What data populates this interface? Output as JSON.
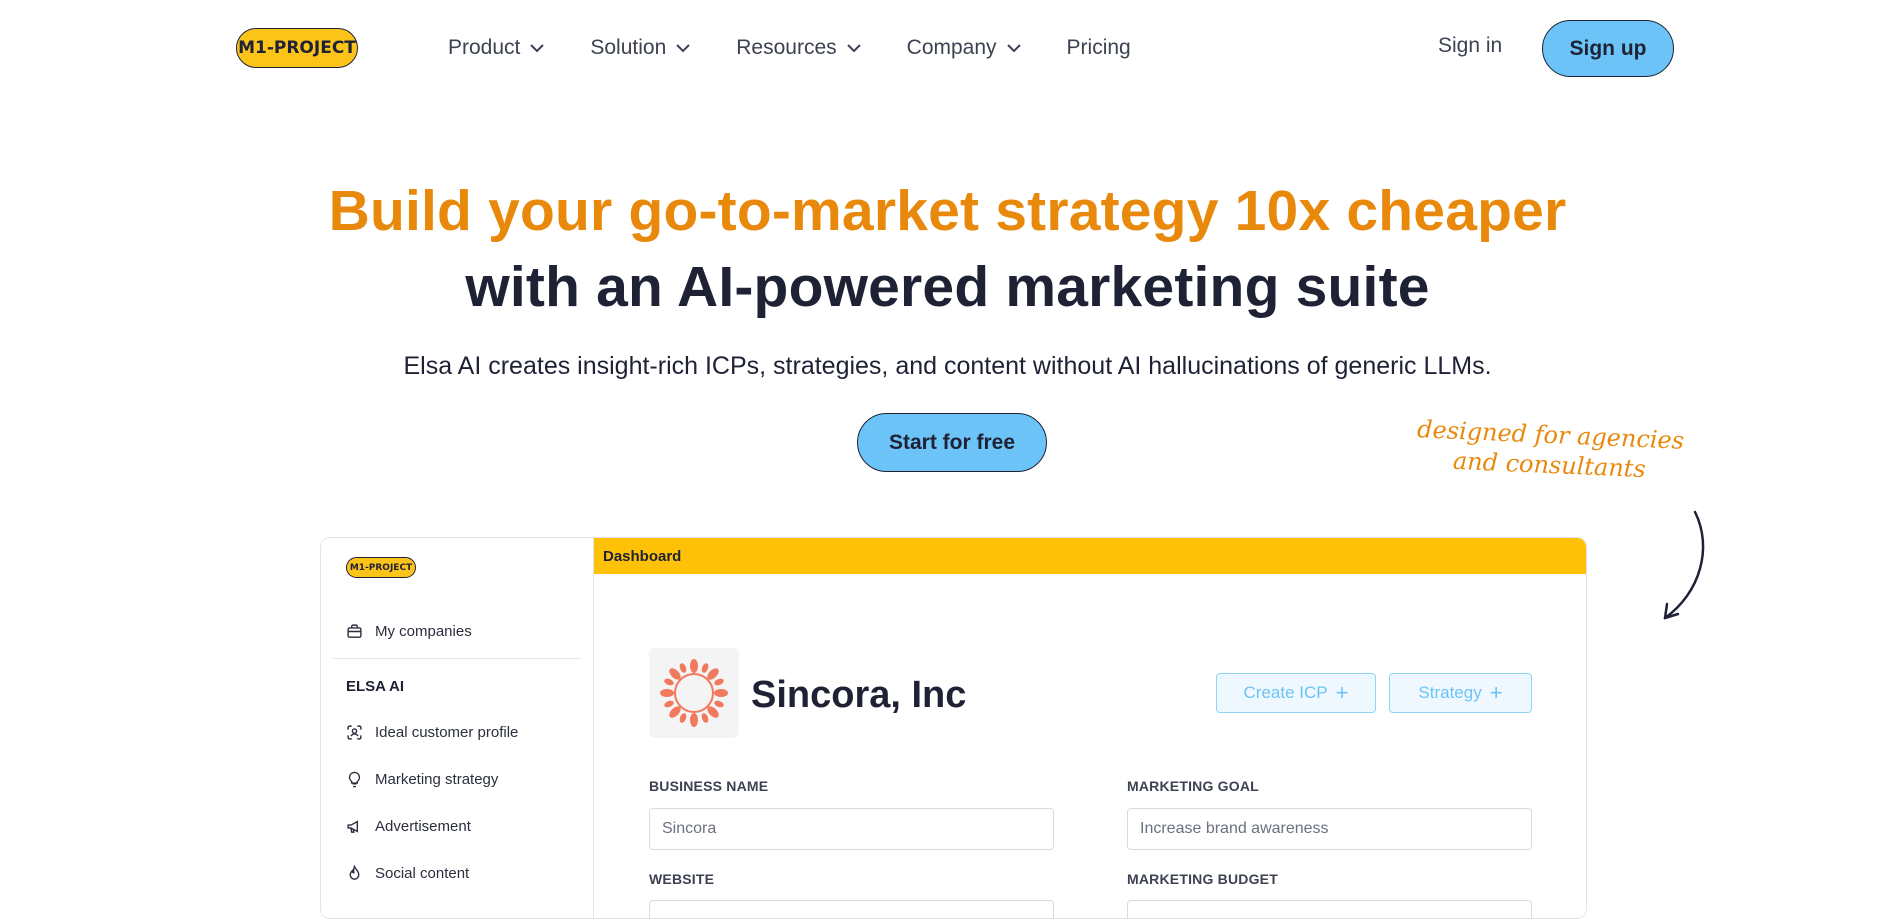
{
  "nav": {
    "logo": "M1-PROJECT",
    "items": [
      {
        "label": "Product",
        "has_dropdown": true
      },
      {
        "label": "Solution",
        "has_dropdown": true
      },
      {
        "label": "Resources",
        "has_dropdown": true
      },
      {
        "label": "Company",
        "has_dropdown": true
      },
      {
        "label": "Pricing",
        "has_dropdown": false
      }
    ],
    "signin": "Sign in",
    "signup": "Sign up"
  },
  "hero": {
    "headline_1": "Build your go-to-market strategy 10x cheaper",
    "headline_2": "with an AI-powered marketing suite",
    "subtitle": "Elsa AI creates insight-rich ICPs, strategies, and content without AI hallucinations of generic LLMs.",
    "cta": "Start for free",
    "note_line_1": "designed for agencies",
    "note_line_2": "and consultants"
  },
  "app": {
    "logo": "M1-PROJECT",
    "sidebar": {
      "my_companies": "My companies",
      "section": "ELSA AI",
      "items": [
        "Ideal customer profile",
        "Marketing strategy",
        "Advertisement",
        "Social content"
      ]
    },
    "topbar_title": "Dashboard",
    "company_name": "Sincora, Inc",
    "buttons": {
      "create_icp": "Create ICP",
      "strategy": "Strategy",
      "plus": "+"
    },
    "form": {
      "business_name_label": "BUSINESS NAME",
      "business_name_value": "Sincora",
      "marketing_goal_label": "MARKETING GOAL",
      "marketing_goal_value": "Increase brand awareness",
      "website_label": "WEBSITE",
      "marketing_budget_label": "MARKETING BUDGET"
    }
  },
  "colors": {
    "accent_orange": "#e8890c",
    "brand_yellow": "#fcc419",
    "button_blue": "#6cc3f7",
    "text_dark": "#1f2235"
  }
}
